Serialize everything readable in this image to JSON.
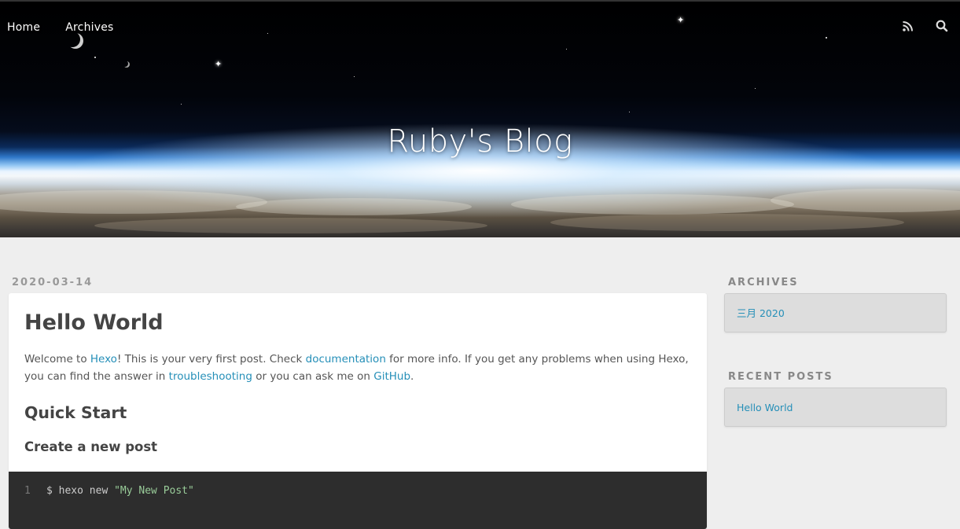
{
  "nav": {
    "items": [
      {
        "label": "Home"
      },
      {
        "label": "Archives"
      }
    ],
    "icons": [
      "rss-icon",
      "search-icon"
    ]
  },
  "site": {
    "title": "Ruby's Blog"
  },
  "post": {
    "date": "2020-03-14",
    "title": "Hello World",
    "intro": {
      "t1": "Welcome to ",
      "link1": "Hexo",
      "t2": "! This is your very first post. Check ",
      "link2": "documentation",
      "t3": " for more info. If you get any problems when using Hexo, you can find the answer in ",
      "link3": "troubleshooting",
      "t4": " or you can ask me on ",
      "link4": "GitHub",
      "t5": "."
    },
    "h2": "Quick Start",
    "h3": "Create a new post",
    "code": {
      "line_number": "1",
      "command": "$ hexo new ",
      "string": "\"My New Post\""
    }
  },
  "sidebar": {
    "archives_title": "ARCHIVES",
    "archives_link": "三月 2020",
    "recent_title": "RECENT POSTS",
    "recent_link": "Hello World"
  },
  "colors": {
    "link": "#258fb8",
    "background": "#eeeeee",
    "code_bg": "#2d2d2d"
  }
}
